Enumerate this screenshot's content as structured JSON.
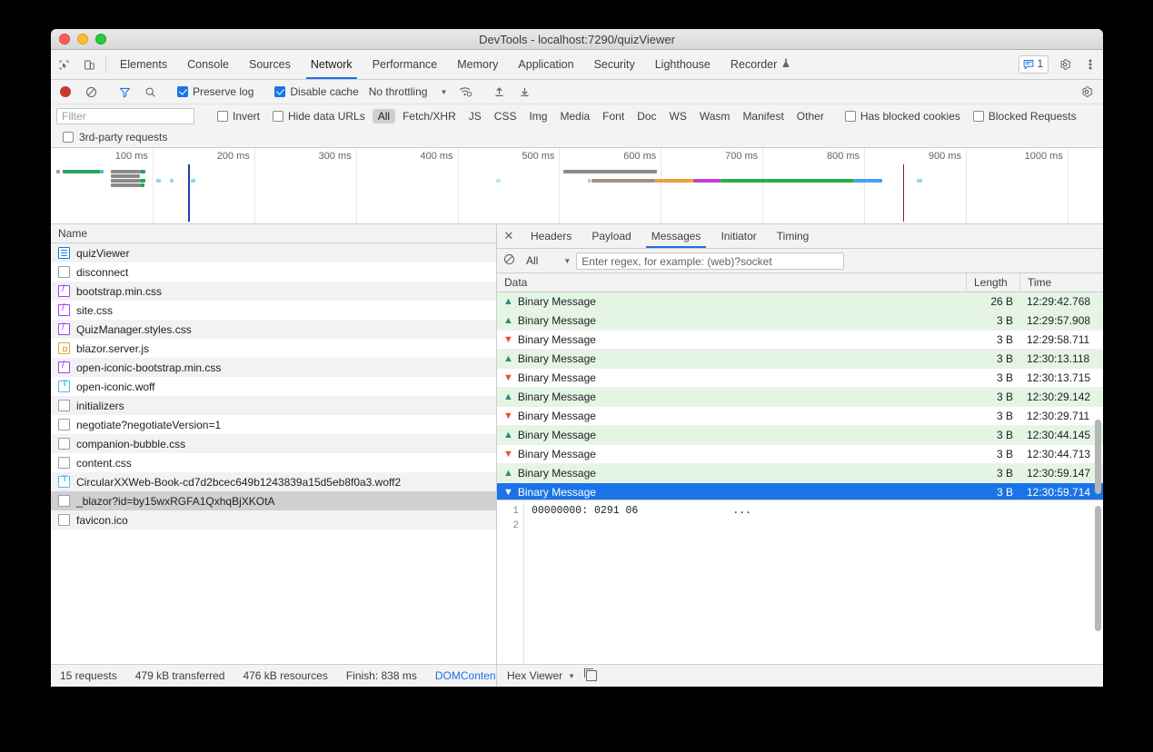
{
  "window": {
    "title": "DevTools - localhost:7290/quizViewer"
  },
  "main_tabs": [
    {
      "label": "Elements",
      "active": false
    },
    {
      "label": "Console",
      "active": false
    },
    {
      "label": "Sources",
      "active": false
    },
    {
      "label": "Network",
      "active": true
    },
    {
      "label": "Performance",
      "active": false
    },
    {
      "label": "Memory",
      "active": false
    },
    {
      "label": "Application",
      "active": false
    },
    {
      "label": "Security",
      "active": false
    },
    {
      "label": "Lighthouse",
      "active": false
    },
    {
      "label": "Recorder",
      "active": false
    }
  ],
  "main_tabs_right": {
    "message_count": "1"
  },
  "network_toolbar": {
    "preserve_log_label": "Preserve log",
    "preserve_log_checked": true,
    "disable_cache_label": "Disable cache",
    "disable_cache_checked": true,
    "throttling_value": "No throttling"
  },
  "filter_bar": {
    "filter_placeholder": "Filter",
    "invert_label": "Invert",
    "hide_data_urls_label": "Hide data URLs",
    "types": [
      "All",
      "Fetch/XHR",
      "JS",
      "CSS",
      "Img",
      "Media",
      "Font",
      "Doc",
      "WS",
      "Wasm",
      "Manifest",
      "Other"
    ],
    "selected_type": "All",
    "has_blocked_cookies_label": "Has blocked cookies",
    "blocked_requests_label": "Blocked Requests",
    "third_party_label": "3rd-party requests"
  },
  "overview": {
    "tick_labels": [
      "100 ms",
      "200 ms",
      "300 ms",
      "400 ms",
      "500 ms",
      "600 ms",
      "700 ms",
      "800 ms",
      "900 ms",
      "1000 ms"
    ],
    "dclm_color": "#1a3fb0",
    "load_color": "#8b1a1a",
    "dclm_position_ms": 135,
    "load_position_ms": 838,
    "bars": [
      {
        "left_ms": 5,
        "width_ms": 4,
        "row": 0,
        "color": "#9e9e9e"
      },
      {
        "left_ms": 12,
        "width_ms": 36,
        "row": 0,
        "color": "#26a65b"
      },
      {
        "left_ms": 48,
        "width_ms": 4,
        "row": 0,
        "color": "#4db6e8"
      },
      {
        "left_ms": 59,
        "width_ms": 29,
        "row": 0,
        "color": "#8a8a8a"
      },
      {
        "left_ms": 59,
        "width_ms": 29,
        "row": 1,
        "color": "#8a8a8a"
      },
      {
        "left_ms": 59,
        "width_ms": 29,
        "row": 2,
        "color": "#8a8a8a"
      },
      {
        "left_ms": 59,
        "width_ms": 29,
        "row": 3,
        "color": "#8a8a8a"
      },
      {
        "left_ms": 88,
        "width_ms": 5,
        "row": 0,
        "color": "#26a65b"
      },
      {
        "left_ms": 88,
        "width_ms": 5,
        "row": 2,
        "color": "#26a65b"
      },
      {
        "left_ms": 88,
        "width_ms": 4,
        "row": 3,
        "color": "#26a65b"
      },
      {
        "left_ms": 104,
        "width_ms": 4,
        "row": 2,
        "color": "#8ed5f0"
      },
      {
        "left_ms": 117,
        "width_ms": 4,
        "row": 2,
        "color": "#8ed5f0"
      },
      {
        "left_ms": 138,
        "width_ms": 4,
        "row": 2,
        "color": "#8ed5f0"
      },
      {
        "left_ms": 438,
        "width_ms": 4,
        "row": 2,
        "color": "#bfe7f5"
      },
      {
        "left_ms": 504,
        "width_ms": 92,
        "row": 0,
        "color": "#8a8a8a"
      },
      {
        "left_ms": 528,
        "width_ms": 3,
        "row": 2,
        "color": "#cdb8b0"
      },
      {
        "left_ms": 532,
        "width_ms": 62,
        "row": 2,
        "color": "#a98e88"
      },
      {
        "left_ms": 594,
        "width_ms": 38,
        "row": 2,
        "color": "#e8a33d"
      },
      {
        "left_ms": 632,
        "width_ms": 27,
        "row": 2,
        "color": "#c23fd3"
      },
      {
        "left_ms": 659,
        "width_ms": 131,
        "row": 2,
        "color": "#2eac4a"
      },
      {
        "left_ms": 790,
        "width_ms": 28,
        "row": 2,
        "color": "#4aa3ef"
      },
      {
        "left_ms": 852,
        "width_ms": 5,
        "row": 2,
        "color": "#9fd4e8"
      }
    ]
  },
  "requests": {
    "column_header": "Name",
    "rows": [
      {
        "name": "quizViewer",
        "icon": "document-icon",
        "type": "doc",
        "selected": false
      },
      {
        "name": "disconnect",
        "icon": "generic-file-icon",
        "type": "other",
        "selected": false
      },
      {
        "name": "bootstrap.min.css",
        "icon": "stylesheet-icon",
        "type": "css",
        "selected": false
      },
      {
        "name": "site.css",
        "icon": "stylesheet-icon",
        "type": "css",
        "selected": false
      },
      {
        "name": "QuizManager.styles.css",
        "icon": "stylesheet-icon",
        "type": "css",
        "selected": false
      },
      {
        "name": "blazor.server.js",
        "icon": "script-icon",
        "type": "js",
        "selected": false
      },
      {
        "name": "open-iconic-bootstrap.min.css",
        "icon": "stylesheet-icon",
        "type": "css",
        "selected": false
      },
      {
        "name": "open-iconic.woff",
        "icon": "font-icon",
        "type": "font",
        "selected": false
      },
      {
        "name": "initializers",
        "icon": "generic-file-icon",
        "type": "other",
        "selected": false
      },
      {
        "name": "negotiate?negotiateVersion=1",
        "icon": "generic-file-icon",
        "type": "other",
        "selected": false
      },
      {
        "name": "companion-bubble.css",
        "icon": "generic-file-icon",
        "type": "other",
        "selected": false
      },
      {
        "name": "content.css",
        "icon": "generic-file-icon",
        "type": "other",
        "selected": false
      },
      {
        "name": "CircularXXWeb-Book-cd7d2bcec649b1243839a15d5eb8f0a3.woff2",
        "icon": "font-icon",
        "type": "font",
        "selected": false
      },
      {
        "name": "_blazor?id=by15wxRGFA1QxhqBjXKOtA",
        "icon": "generic-file-icon",
        "type": "other",
        "selected": true
      },
      {
        "name": "favicon.ico",
        "icon": "generic-file-icon",
        "type": "other",
        "selected": false
      }
    ]
  },
  "detail": {
    "tabs": [
      {
        "label": "Headers",
        "active": false
      },
      {
        "label": "Payload",
        "active": false
      },
      {
        "label": "Messages",
        "active": true
      },
      {
        "label": "Initiator",
        "active": false
      },
      {
        "label": "Timing",
        "active": false
      }
    ],
    "message_filter": {
      "type_value": "All",
      "regex_placeholder": "Enter regex, for example: (web)?socket"
    },
    "columns": {
      "data": "Data",
      "length": "Length",
      "time": "Time"
    },
    "messages": [
      {
        "direction": "sent",
        "label": "Binary Message",
        "length": "26 B",
        "time": "12:29:42.768",
        "selected": false
      },
      {
        "direction": "sent",
        "label": "Binary Message",
        "length": "3 B",
        "time": "12:29:57.908",
        "selected": false
      },
      {
        "direction": "received",
        "label": "Binary Message",
        "length": "3 B",
        "time": "12:29:58.711",
        "selected": false
      },
      {
        "direction": "sent",
        "label": "Binary Message",
        "length": "3 B",
        "time": "12:30:13.118",
        "selected": false
      },
      {
        "direction": "received",
        "label": "Binary Message",
        "length": "3 B",
        "time": "12:30:13.715",
        "selected": false
      },
      {
        "direction": "sent",
        "label": "Binary Message",
        "length": "3 B",
        "time": "12:30:29.142",
        "selected": false
      },
      {
        "direction": "received",
        "label": "Binary Message",
        "length": "3 B",
        "time": "12:30:29.711",
        "selected": false
      },
      {
        "direction": "sent",
        "label": "Binary Message",
        "length": "3 B",
        "time": "12:30:44.145",
        "selected": false
      },
      {
        "direction": "received",
        "label": "Binary Message",
        "length": "3 B",
        "time": "12:30:44.713",
        "selected": false
      },
      {
        "direction": "sent",
        "label": "Binary Message",
        "length": "3 B",
        "time": "12:30:59.147",
        "selected": false
      },
      {
        "direction": "received",
        "label": "Binary Message",
        "length": "3 B",
        "time": "12:30:59.714",
        "selected": true
      }
    ],
    "hex": {
      "line_numbers": [
        "1",
        "2"
      ],
      "line1_offset": "00000000: 0291 06",
      "line1_ascii": "..."
    }
  },
  "status_bar": {
    "requests": "15 requests",
    "transferred": "479 kB transferred",
    "resources": "476 kB resources",
    "finish": "Finish: 838 ms",
    "domcontent": "DOMConten",
    "viewer_label": "Hex Viewer"
  }
}
